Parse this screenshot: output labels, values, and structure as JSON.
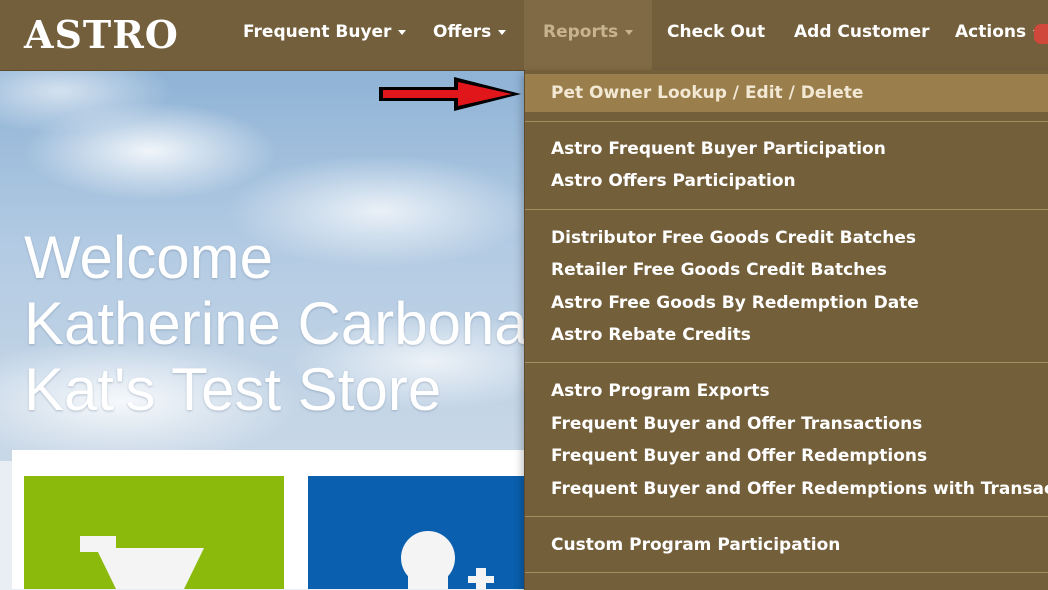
{
  "navbar": {
    "logo": "ASTRO",
    "items": [
      {
        "label": "Frequent Buyer",
        "has_caret": true
      },
      {
        "label": "Offers",
        "has_caret": true
      },
      {
        "label": "Reports",
        "has_caret": true,
        "active": true
      },
      {
        "label": "Check Out",
        "has_caret": false
      },
      {
        "label": "Add Customer",
        "has_caret": false
      },
      {
        "label": "Actions",
        "has_caret": true
      }
    ]
  },
  "hero": {
    "line1": "Welcome",
    "line2": "Katherine Carbonara",
    "line3": "Kat's Test Store"
  },
  "tiles": [
    {
      "icon": "cart-icon",
      "color": "#8cba0c"
    },
    {
      "icon": "add-user-icon",
      "color": "#0a5fae"
    }
  ],
  "annotation": {
    "icon": "red-arrow-icon",
    "color": "#e0161b"
  },
  "reports_menu": {
    "groups": [
      [
        "Pet Owner Lookup / Edit / Delete"
      ],
      [
        "Astro Frequent Buyer Participation",
        "Astro Offers Participation"
      ],
      [
        "Distributor Free Goods Credit Batches",
        "Retailer Free Goods Credit Batches",
        "Astro Free Goods By Redemption Date",
        "Astro Rebate Credits"
      ],
      [
        "Astro Program Exports",
        "Frequent Buyer and Offer Transactions",
        "Frequent Buyer and Offer Redemptions",
        "Frequent Buyer and Offer Redemptions with Transactions"
      ],
      [
        "Custom Program Participation"
      ]
    ]
  },
  "colors": {
    "navbar": "#735f3c",
    "menu_bg": "#745f3b",
    "menu_highlight": "#9a7e4c",
    "reports_active_text": "#c7b48f"
  }
}
